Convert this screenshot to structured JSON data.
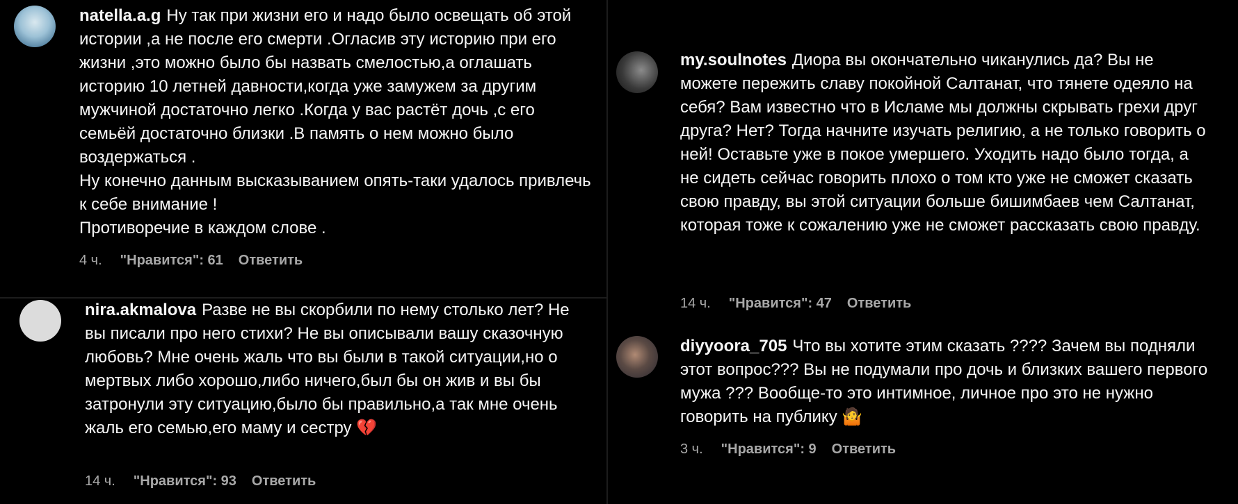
{
  "comments": [
    {
      "username": "natella.a.g",
      "text": "Ну так при жизни его и надо было освещать об этой истории ,а не после его смерти .Огласив эту историю при его жизни ,это можно было бы назвать смелостью,а оглашать историю 10 летней давности,когда уже замужем за другим мужчиной достаточно легко .Когда у вас растёт дочь ,с его семьёй достаточно близки .В память о нем можно было воздержаться .",
      "text2": "Ну конечно данным высказыванием опять-таки удалось привлечь к себе внимание !",
      "text3": "Противоречие в каждом слове .",
      "time": "4 ч.",
      "likes": "\"Нравится\": 61",
      "reply": "Ответить",
      "avatar_icon": "avatar-photo"
    },
    {
      "username": "nira.akmalova",
      "text": "Разве не вы скорбили по нему столько лет? Не вы писали про него стихи? Не вы описывали вашу сказочную любовь? Мне очень жаль что вы были в такой ситуации,но о мертвых либо хорошо,либо ничего,был бы он жив и вы бы затронули эту ситуацию,было бы правильно,а так мне очень жаль его семью,его маму и сестру",
      "emoji": "💔",
      "time": "14 ч.",
      "likes": "\"Нравится\": 93",
      "reply": "Ответить",
      "avatar_icon": "default-avatar"
    },
    {
      "username": "my.soulnotes",
      "text": "Диора вы окончательно чиканулись да? Вы не можете пережить славу покойной Салтанат, что тянете одеяло на себя? Вам известно что в Исламе мы должны скрывать грехи друг друга? Нет? Тогда начните изучать религию, а не только говорить о ней! Оставьте уже в покое умершего. Уходить надо было тогда, а не сидеть сейчас говорить плохо о том кто уже не сможет сказать свою правду, вы этой ситуации больше бишимбаев чем Салтанат, которая тоже к сожалению уже не сможет рассказать свою правду.",
      "time": "14 ч.",
      "likes": "\"Нравится\": 47",
      "reply": "Ответить",
      "avatar_icon": "avatar-photo"
    },
    {
      "username": "diyyoora_705",
      "text": "Что вы хотите этим сказать ???? Зачем вы подняли этот вопрос??? Вы не подумали про дочь и близких вашего первого мужа ??? Вообще-то это интимное, личное про это не нужно говорить на публику",
      "emoji": "🤷",
      "time": "3 ч.",
      "likes": "\"Нравится\": 9",
      "reply": "Ответить",
      "avatar_icon": "avatar-photo"
    }
  ]
}
